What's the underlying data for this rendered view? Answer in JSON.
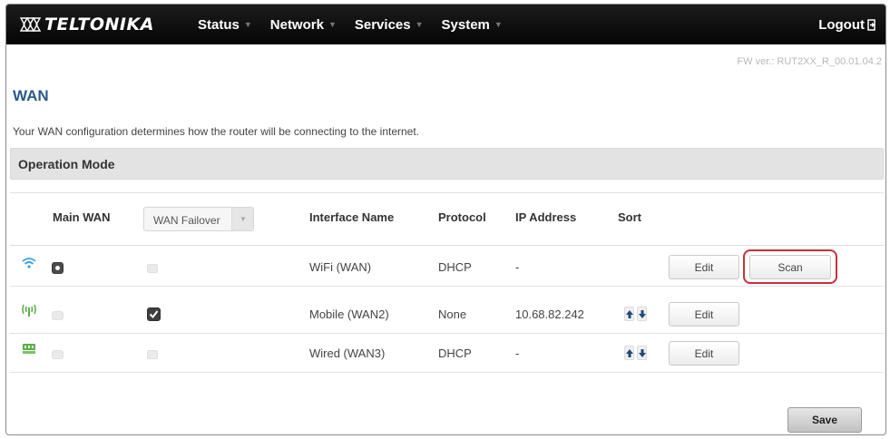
{
  "header": {
    "logo_text": "TELTONIKA",
    "nav": [
      {
        "label": "Status"
      },
      {
        "label": "Network"
      },
      {
        "label": "Services"
      },
      {
        "label": "System"
      }
    ],
    "logout_label": "Logout"
  },
  "firmware": "FW ver.: RUT2XX_R_00.01.04.2",
  "page": {
    "title": "WAN",
    "description": "Your WAN configuration determines how the router will be connecting to the internet."
  },
  "section": {
    "title": "Operation Mode"
  },
  "table": {
    "headers": {
      "main_wan": "Main WAN",
      "interface_name": "Interface Name",
      "protocol": "Protocol",
      "ip_address": "IP Address",
      "sort": "Sort"
    },
    "mode_select": {
      "value": "WAN Failover"
    },
    "rows": [
      {
        "icon": "wifi-icon",
        "main_wan": true,
        "failover": false,
        "interface_name": "WiFi (WAN)",
        "protocol": "DHCP",
        "ip_address": "-",
        "has_sort": false,
        "edit_label": "Edit",
        "scan_label": "Scan"
      },
      {
        "icon": "mobile-icon",
        "main_wan": false,
        "failover": true,
        "interface_name": "Mobile (WAN2)",
        "protocol": "None",
        "ip_address": "10.68.82.242",
        "has_sort": true,
        "edit_label": "Edit"
      },
      {
        "icon": "wired-icon",
        "main_wan": false,
        "failover": false,
        "interface_name": "Wired (WAN3)",
        "protocol": "DHCP",
        "ip_address": "-",
        "has_sort": true,
        "edit_label": "Edit"
      }
    ]
  },
  "save_label": "Save",
  "colors": {
    "title_blue": "#2a5a8c",
    "highlight_red": "#c8303a",
    "nav_bg": "#111111"
  }
}
